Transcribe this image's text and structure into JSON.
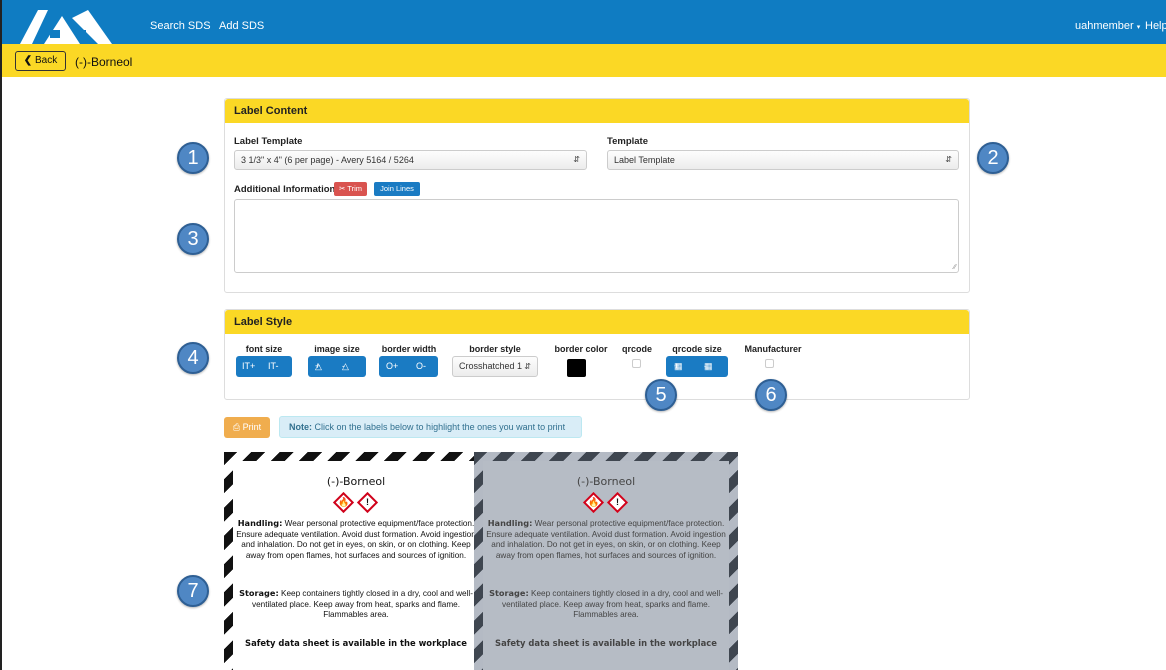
{
  "nav": {
    "links": [
      "Search SDS",
      "Add SDS"
    ],
    "user": "uahmember",
    "help": "Help"
  },
  "header": {
    "back_label": "Back",
    "title": "(-)-Borneol"
  },
  "label_content": {
    "title": "Label Content",
    "label_template_label": "Label Template",
    "label_template_value": "3 1/3\" x 4\" (6 per page) - Avery 5164 / 5264",
    "template_label": "Template",
    "template_value": "Label Template",
    "additional_info_label": "Additional Information",
    "trim_label": "Trim",
    "join_lines_label": "Join Lines",
    "additional_info_value": ""
  },
  "label_style": {
    "title": "Label Style",
    "font_size_label": "font size",
    "font_up": "IT+",
    "font_down": "IT-",
    "image_size_label": "image size",
    "image_up": "A+",
    "image_down": "A-",
    "border_width_label": "border width",
    "border_up": "O+",
    "border_down": "O-",
    "border_style_label": "border style",
    "border_style_value": "Crosshatched 1",
    "border_color_label": "border color",
    "border_color": "#000000",
    "qrcode_label": "qrcode",
    "qrcode_size_label": "qrcode size",
    "qr_up": "+",
    "qr_down": "-",
    "manufacturer_label": "Manufacturer"
  },
  "actions": {
    "print_label": "Print",
    "note_bold": "Note:",
    "note_text": " Click on the labels below to highlight the ones you want to print"
  },
  "callouts": [
    "1",
    "2",
    "3",
    "4",
    "5",
    "6",
    "7"
  ],
  "labels": [
    {
      "name": "(-)-Borneol",
      "pictograms": [
        "flame-icon",
        "exclamation-icon"
      ],
      "handling_head": "Handling:",
      "handling_text": " Wear personal protective equipment/face protection. Ensure adequate ventilation. Avoid dust formation. Avoid ingestion and inhalation. Do not get in eyes, on skin, or on clothing. Keep away from open flames, hot surfaces and sources of ignition.",
      "storage_head": "Storage:",
      "storage_text": " Keep containers tightly closed in a dry, cool and well-ventilated place. Keep away from heat, sparks and flame. Flammables area.",
      "footer": "Safety data sheet is available in the workplace"
    },
    {
      "name": "(-)-Borneol",
      "pictograms": [
        "flame-icon",
        "exclamation-icon"
      ],
      "handling_head": "Handling:",
      "handling_text": " Wear personal protective equipment/face protection. Ensure adequate ventilation. Avoid dust formation. Avoid ingestion and inhalation. Do not get in eyes, on skin, or on clothing. Keep away from open flames, hot surfaces and sources of ignition.",
      "storage_head": "Storage:",
      "storage_text": " Keep containers tightly closed in a dry, cool and well-ventilated place. Keep away from heat, sparks and flame. Flammables area.",
      "footer": "Safety data sheet is available in the workplace"
    }
  ],
  "colors": {
    "nav_blue": "#0f7cc2",
    "yellow": "#fbd825",
    "button_blue": "#1a7bc3",
    "danger_red": "#d9534f",
    "warning_orange": "#f0ad4e",
    "callout_blue": "#4f87c4"
  }
}
